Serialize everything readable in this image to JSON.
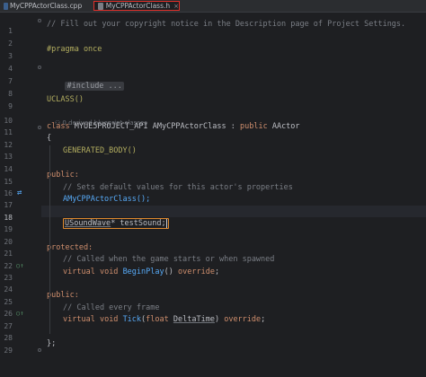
{
  "tabs": [
    {
      "label": "MyCPPActorClass.cpp"
    },
    {
      "label": "MyCPPActorClass.h",
      "close": "×"
    }
  ],
  "gutter": {
    "line_numbers": [
      "1",
      "2",
      "3",
      "4",
      "7",
      "8",
      "9",
      "10",
      "11",
      "12",
      "13",
      "14",
      "15",
      "16",
      "17",
      "18",
      "19",
      "20",
      "21",
      "22",
      "23",
      "24",
      "25",
      "26",
      "27",
      "28",
      "29"
    ],
    "override_icon": "⇄",
    "inherit_icon": "○↑"
  },
  "code": {
    "l1": "// Fill out your copyright notice in the Description page of Project Settings.",
    "l3_kw": "#pragma once",
    "l7_collapsed": "#include ...",
    "l9": "UCLASS()",
    "hint": "0 derived blueprint classes",
    "l10_class": "class",
    "l10_api": "MYUE5PROJECT_API",
    "l10_name": "AMyCPPActorClass",
    "l10_colon": " : ",
    "l10_public": "public",
    "l10_base": "AActor",
    "l11": "{",
    "l12": "GENERATED_BODY()",
    "l14": "public:",
    "l15": "// Sets default values for this actor's properties",
    "l16": "AMyCPPActorClass();",
    "l18_type": "USoundWave",
    "l18_rest": "* testSound;",
    "l20": "protected:",
    "l21": "// Called when the game starts or when spawned",
    "l22_virtual": "virtual",
    "l22_void": "void",
    "l22_fn": "BeginPlay",
    "l22_paren": "()",
    "l22_override": "override",
    "l22_semi": ";",
    "l24": "public:",
    "l25": "// Called every frame",
    "l26_virtual": "virtual",
    "l26_void": "void",
    "l26_fn": "Tick",
    "l26_open": "(",
    "l26_float": "float",
    "l26_param": "DeltaTime",
    "l26_close": ")",
    "l26_override": "override",
    "l26_semi": ";",
    "l28": "};"
  }
}
